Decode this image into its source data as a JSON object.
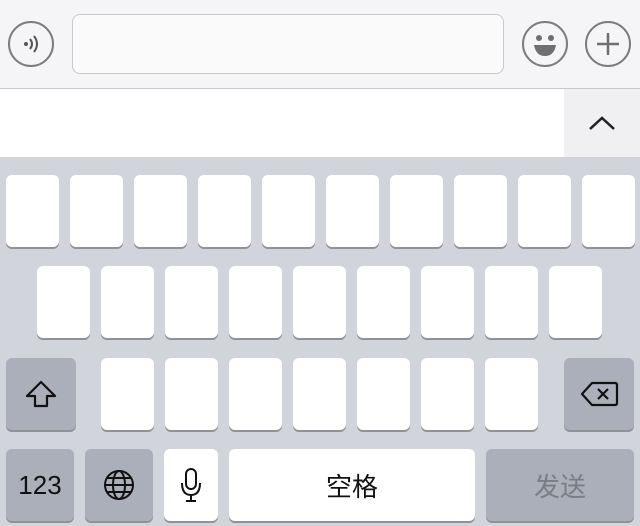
{
  "input_bar": {
    "voice_icon": "voice-wave-icon",
    "text_value": "",
    "text_placeholder": "",
    "emoji_icon": "emoji-face-icon",
    "add_icon": "plus-icon"
  },
  "candidates": {
    "expand_icon": "chevron-up-icon"
  },
  "keyboard": {
    "row1_count": 10,
    "row2_count": 9,
    "row3_count": 7,
    "shift_icon": "shift-arrow-icon",
    "backspace_icon": "backspace-icon",
    "numbers_label": "123",
    "globe_icon": "globe-icon",
    "mic_icon": "microphone-icon",
    "space_label": "空格",
    "send_label": "发送"
  },
  "colors": {
    "keyboard_bg": "#d1d4da",
    "key_bg": "#ffffff",
    "fn_key_bg": "#abafb9",
    "send_text": "#7a7d84"
  }
}
